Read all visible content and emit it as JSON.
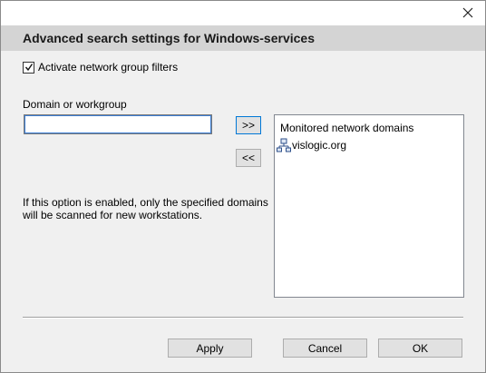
{
  "dialog": {
    "title": "Advanced search settings for Windows-services",
    "close_icon": "close-icon"
  },
  "filter": {
    "checkbox_label": "Activate network group filters",
    "checked": true
  },
  "domain_input": {
    "label": "Domain or workgroup",
    "value": ""
  },
  "transfer": {
    "add_label": ">>",
    "remove_label": "<<"
  },
  "monitored": {
    "header": "Monitored network domains",
    "items": [
      {
        "name": "vislogic.org",
        "icon": "network-domain-icon"
      }
    ]
  },
  "info": {
    "text": "If this option is enabled, only the specified domains will be scanned for new workstations."
  },
  "footer": {
    "apply_label": "Apply",
    "cancel_label": "Cancel",
    "ok_label": "OK"
  }
}
